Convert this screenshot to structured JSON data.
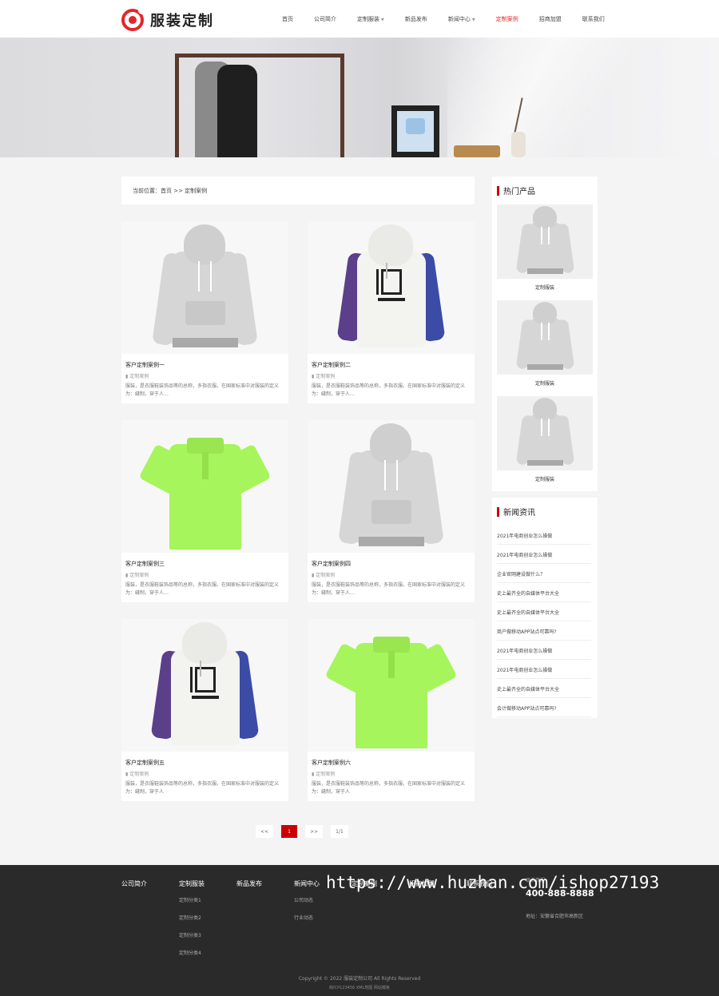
{
  "header": {
    "logo_text": "服装定制",
    "nav": [
      {
        "label": "首页"
      },
      {
        "label": "公司简介"
      },
      {
        "label": "定制服装",
        "dropdown": true
      },
      {
        "label": "新品发布"
      },
      {
        "label": "新闻中心",
        "dropdown": true
      },
      {
        "label": "定制案例",
        "active": true
      },
      {
        "label": "招商加盟"
      },
      {
        "label": "联系我们"
      }
    ]
  },
  "breadcrumb": {
    "text": "当前位置：首页 >> 定制案例"
  },
  "cases": [
    {
      "title": "客户定制案例一",
      "category": "定制案例",
      "desc": "服装，是衣服鞋装饰品等的总称，多指衣服。在国家标准中对服装的定义为：缝制，穿于人…",
      "style": "grey-hoodie"
    },
    {
      "title": "客户定制案例二",
      "category": "定制案例",
      "desc": "服装，是衣服鞋装饰品等的总称，多指衣服。在国家标准中对服装的定义为：缝制，穿于人…",
      "style": "white-hoodie"
    },
    {
      "title": "客户定制案例三",
      "category": "定制案例",
      "desc": "服装，是衣服鞋装饰品等的总称，多指衣服。在国家标准中对服装的定义为：缝制，穿于人…",
      "style": "green-polo"
    },
    {
      "title": "客户定制案例四",
      "category": "定制案例",
      "desc": "服装，是衣服鞋装饰品等的总称，多指衣服。在国家标准中对服装的定义为：缝制，穿于人…",
      "style": "grey-hoodie"
    },
    {
      "title": "客户定制案例五",
      "category": "定制案例",
      "desc": "服装，是衣服鞋装饰品等的总称，多指衣服。在国家标准中对服装的定义为：缝制，穿于人",
      "style": "white-hoodie"
    },
    {
      "title": "客户定制案例六",
      "category": "定制案例",
      "desc": "服装，是衣服鞋装饰品等的总称，多指衣服。在国家标准中对服装的定义为：缝制，穿于人",
      "style": "green-polo"
    }
  ],
  "pagination": {
    "prev": "<<",
    "current": "1",
    "next": ">>",
    "summary": "1/1"
  },
  "sidebar": {
    "hot_title": "热门产品",
    "hot_products": [
      {
        "label": "定制服装"
      },
      {
        "label": "定制服装"
      },
      {
        "label": "定制服装"
      }
    ],
    "news_title": "新闻资讯",
    "news": [
      "2021年电商创业怎么操做",
      "2021年电商创业怎么操做",
      "企业官网建设做什么？",
      "史上最齐全的自媒体平台大全",
      "史上最齐全的自媒体平台大全",
      "商户做移动APP站点可靠吗?",
      "2021年电商创业怎么操做",
      "2021年电商创业怎么操做",
      "史上最齐全的自媒体平台大全",
      "会计做移动APP站点可靠吗?"
    ]
  },
  "footer": {
    "columns": [
      {
        "head": "公司简介",
        "links": []
      },
      {
        "head": "定制服装",
        "links": [
          "定制分类1",
          "定制分类2",
          "定制分类3",
          "定制分类4"
        ]
      },
      {
        "head": "新品发布",
        "links": []
      },
      {
        "head": "新闻中心",
        "links": [
          "公司动态",
          "行业动态"
        ]
      },
      {
        "head": "定制案例",
        "links": []
      },
      {
        "head": "招商加盟",
        "links": []
      },
      {
        "head": "联系我们",
        "links": []
      }
    ],
    "contact_label": "联系我们",
    "phone": "400-888-8888",
    "address": "地址：安徽省合肥市高新区",
    "watermark": "https://www.huzhan.com/ishop27193",
    "copyright": "Copyright © 2022 服装定制公司 All Rights Reserved",
    "icp": "皖ICP123456 XML地图 网站模板"
  },
  "colors": {
    "accent": "#cc0000",
    "grey_hoodie": "#d6d6d6",
    "green_polo": "#a6f55c",
    "purple": "#5b3f8a",
    "blue": "#3c4ba6"
  }
}
